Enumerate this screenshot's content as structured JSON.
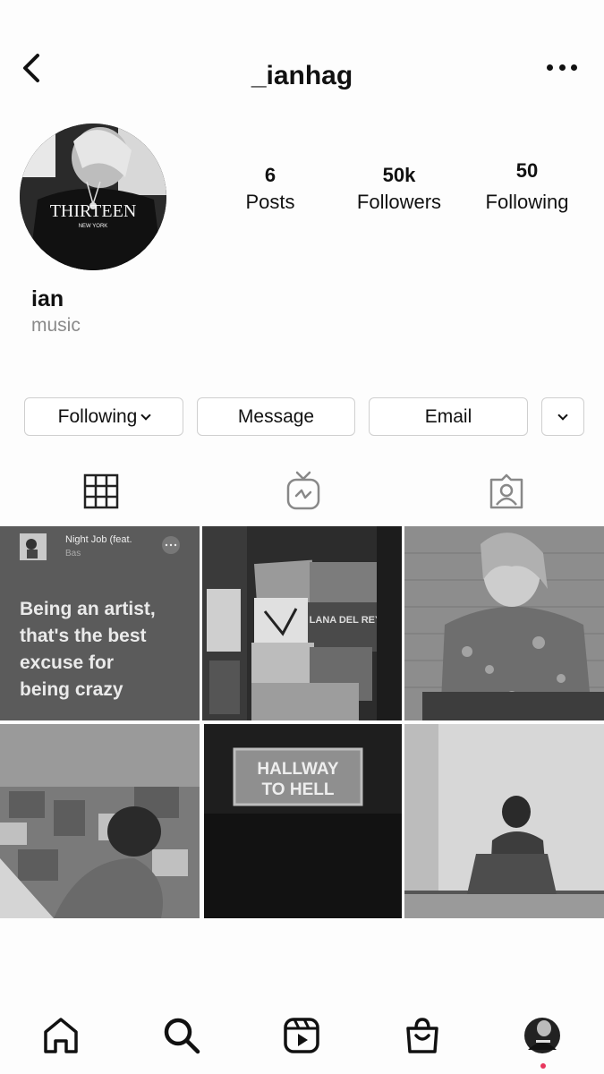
{
  "header": {
    "username": "_ianhag"
  },
  "profile": {
    "name": "ian",
    "bio": "music",
    "stats": [
      {
        "value": "6",
        "label": "Posts"
      },
      {
        "value": "50k",
        "label": "Followers"
      },
      {
        "value": "50",
        "label": "Following"
      }
    ],
    "avatar_shirt_text": "THIRTEEN",
    "avatar_shirt_subtext": "NEW YORK"
  },
  "actions": {
    "following_label": "Following",
    "message_label": "Message",
    "email_label": "Email"
  },
  "tabs": [
    {
      "icon": "grid-icon",
      "active": true
    },
    {
      "icon": "igtv-icon",
      "active": false
    },
    {
      "icon": "tagged-icon",
      "active": false
    }
  ],
  "posts": {
    "post1": {
      "song_title": "Night Job (feat.",
      "song_artist": "Bas",
      "quote": [
        "Being an artist,",
        "that's the best",
        "excuse for",
        "being crazy"
      ]
    },
    "post2": {
      "record_label": "LANA DEL REY"
    },
    "post5": {
      "sign_line1": "HALLWAY",
      "sign_line2": "TO HELL"
    }
  },
  "bottom_nav": [
    {
      "icon": "home-icon"
    },
    {
      "icon": "search-icon"
    },
    {
      "icon": "reels-icon"
    },
    {
      "icon": "shop-icon"
    },
    {
      "icon": "profile-avatar-icon"
    }
  ],
  "colors": {
    "notification_dot": "#e8365d",
    "bio_gray": "#8a8a8a",
    "border": "#cfcfcf"
  }
}
